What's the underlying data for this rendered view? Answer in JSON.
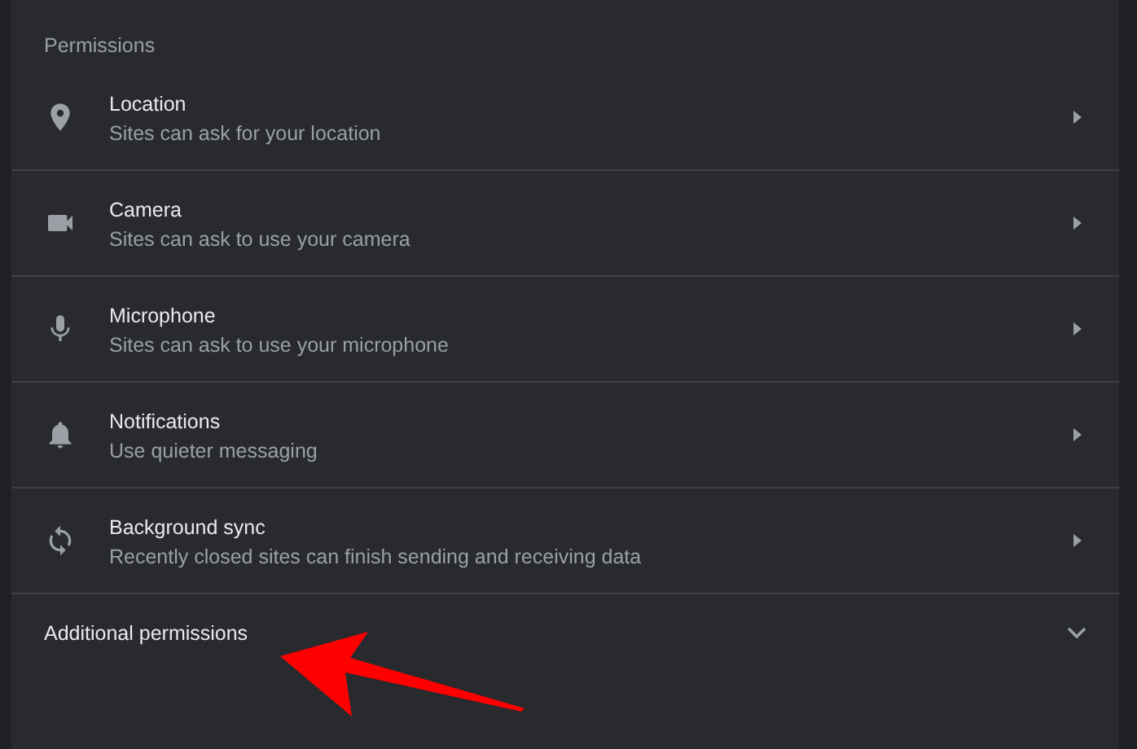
{
  "section": {
    "title": "Permissions"
  },
  "items": [
    {
      "kind": "location",
      "title": "Location",
      "subtitle": "Sites can ask for your location"
    },
    {
      "kind": "camera",
      "title": "Camera",
      "subtitle": "Sites can ask to use your camera"
    },
    {
      "kind": "microphone",
      "title": "Microphone",
      "subtitle": "Sites can ask to use your microphone"
    },
    {
      "kind": "notifications",
      "title": "Notifications",
      "subtitle": "Use quieter messaging"
    },
    {
      "kind": "sync",
      "title": "Background sync",
      "subtitle": "Recently closed sites can finish sending and receiving data"
    }
  ],
  "additional": {
    "label": "Additional permissions",
    "expanded": false
  }
}
